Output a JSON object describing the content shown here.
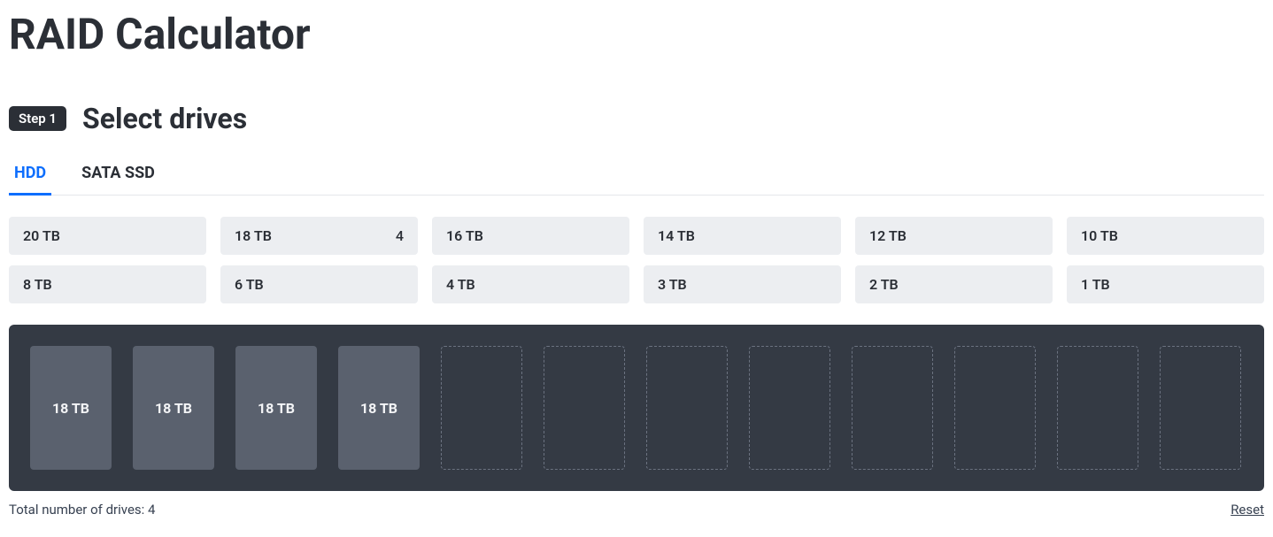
{
  "page": {
    "title": "RAID Calculator"
  },
  "step": {
    "badge": "Step 1",
    "title": "Select drives"
  },
  "tabs": [
    {
      "label": "HDD",
      "active": true
    },
    {
      "label": "SATA SSD",
      "active": false
    }
  ],
  "driveOptions": [
    {
      "label": "20 TB",
      "count": ""
    },
    {
      "label": "18 TB",
      "count": "4"
    },
    {
      "label": "16 TB",
      "count": ""
    },
    {
      "label": "14 TB",
      "count": ""
    },
    {
      "label": "12 TB",
      "count": ""
    },
    {
      "label": "10 TB",
      "count": ""
    },
    {
      "label": "8 TB",
      "count": ""
    },
    {
      "label": "6 TB",
      "count": ""
    },
    {
      "label": "4 TB",
      "count": ""
    },
    {
      "label": "3 TB",
      "count": ""
    },
    {
      "label": "2 TB",
      "count": ""
    },
    {
      "label": "1 TB",
      "count": ""
    }
  ],
  "bays": {
    "slots": [
      {
        "filled": true,
        "label": "18 TB"
      },
      {
        "filled": true,
        "label": "18 TB"
      },
      {
        "filled": true,
        "label": "18 TB"
      },
      {
        "filled": true,
        "label": "18 TB"
      },
      {
        "filled": false,
        "label": ""
      },
      {
        "filled": false,
        "label": ""
      },
      {
        "filled": false,
        "label": ""
      },
      {
        "filled": false,
        "label": ""
      },
      {
        "filled": false,
        "label": ""
      },
      {
        "filled": false,
        "label": ""
      },
      {
        "filled": false,
        "label": ""
      },
      {
        "filled": false,
        "label": ""
      }
    ]
  },
  "footer": {
    "totalText": "Total number of drives: 4",
    "resetLabel": "Reset"
  }
}
